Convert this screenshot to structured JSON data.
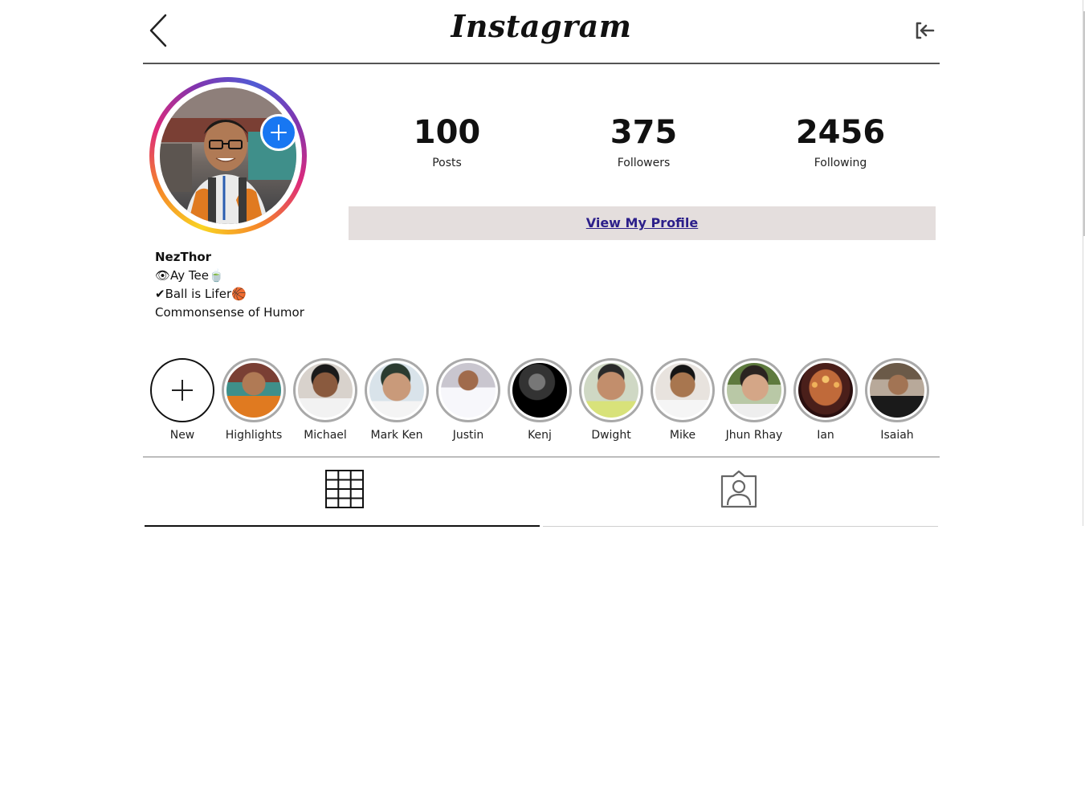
{
  "header": {
    "logo_text": "Instagram",
    "back_icon": "chevron-left-icon",
    "logout_icon": "logout-icon"
  },
  "profile": {
    "username": "NezThor",
    "bio_lines": [
      "👁Ay Tee🍵",
      "✔Ball is Lifer🏀",
      "Commonsense of Humor"
    ],
    "add_story_icon": "plus-icon",
    "ring_colors": [
      "#f9d423",
      "#f58529",
      "#dd2a7b",
      "#8134af",
      "#515bd4"
    ]
  },
  "stats": {
    "posts": {
      "value": "100",
      "label": "Posts"
    },
    "followers": {
      "value": "375",
      "label": "Followers"
    },
    "following": {
      "value": "2456",
      "label": "Following"
    }
  },
  "actions": {
    "view_profile_label": "View My Profile"
  },
  "highlights": [
    {
      "label": "New"
    },
    {
      "label": "Highlights"
    },
    {
      "label": "Michael"
    },
    {
      "label": "Mark Ken"
    },
    {
      "label": "Justin"
    },
    {
      "label": "Kenj"
    },
    {
      "label": "Dwight"
    },
    {
      "label": "Mike"
    },
    {
      "label": "Jhun Rhay"
    },
    {
      "label": "Ian"
    },
    {
      "label": "Isaiah"
    }
  ],
  "tabs": [
    {
      "name": "posts-grid",
      "icon": "grid-icon",
      "active": true
    },
    {
      "name": "tagged",
      "icon": "tagged-person-icon",
      "active": false
    }
  ],
  "colors": {
    "accent_blue": "#1877f2",
    "button_bg": "#e4dedd",
    "link_color": "#2c1f8a"
  }
}
